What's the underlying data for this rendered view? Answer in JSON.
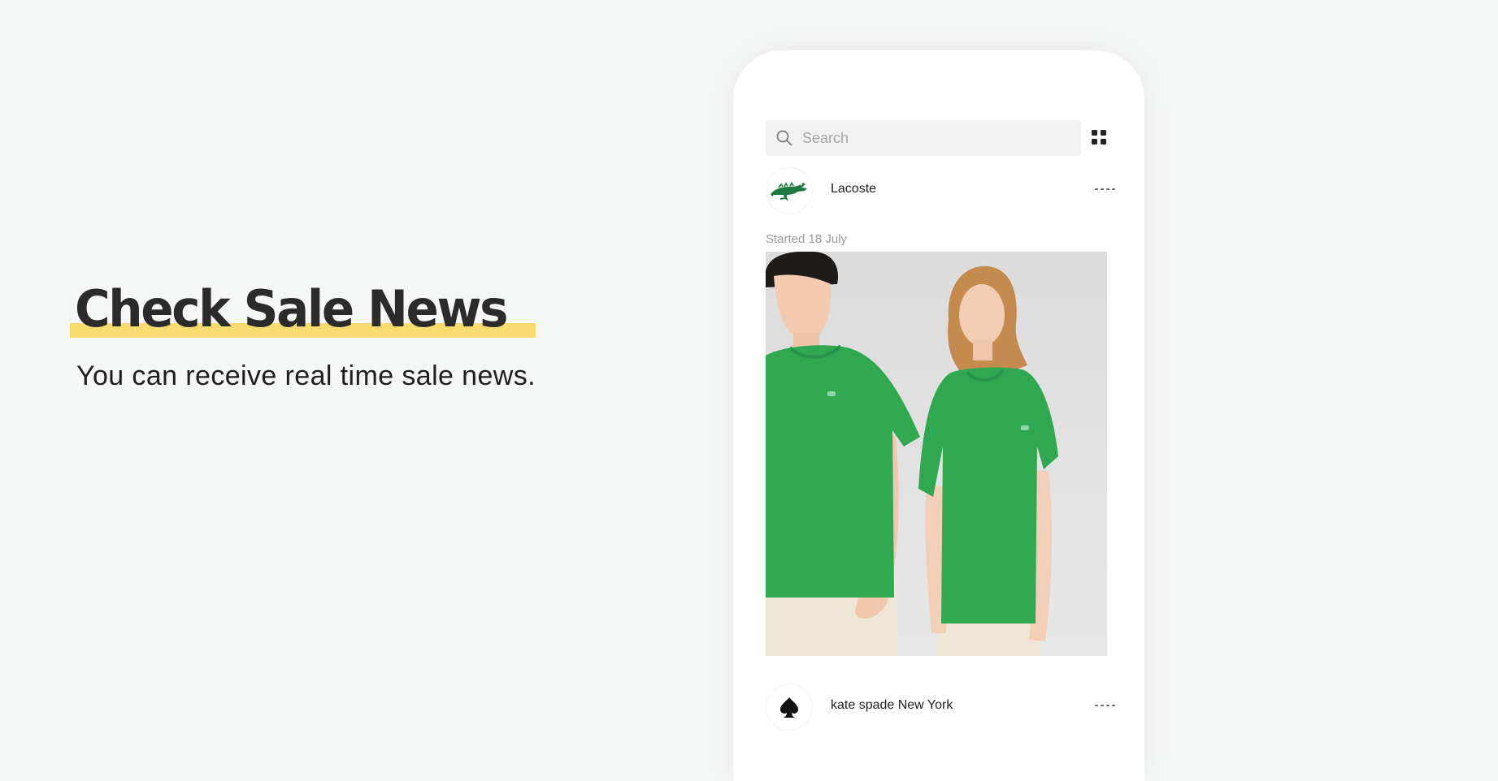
{
  "promo": {
    "headline": "Check Sale News",
    "subtitle": "You can receive real time sale news."
  },
  "app": {
    "search": {
      "placeholder": "Search"
    },
    "feed": [
      {
        "brand": "Lacoste",
        "date": "Started 18 July",
        "logo": "crocodile-logo"
      },
      {
        "brand": "kate spade New York",
        "logo": "spade-logo"
      }
    ]
  },
  "colors": {
    "highlight": "#f7dc6f",
    "page_background": "#f5f6f6",
    "shirt_green": "#2fa850"
  }
}
